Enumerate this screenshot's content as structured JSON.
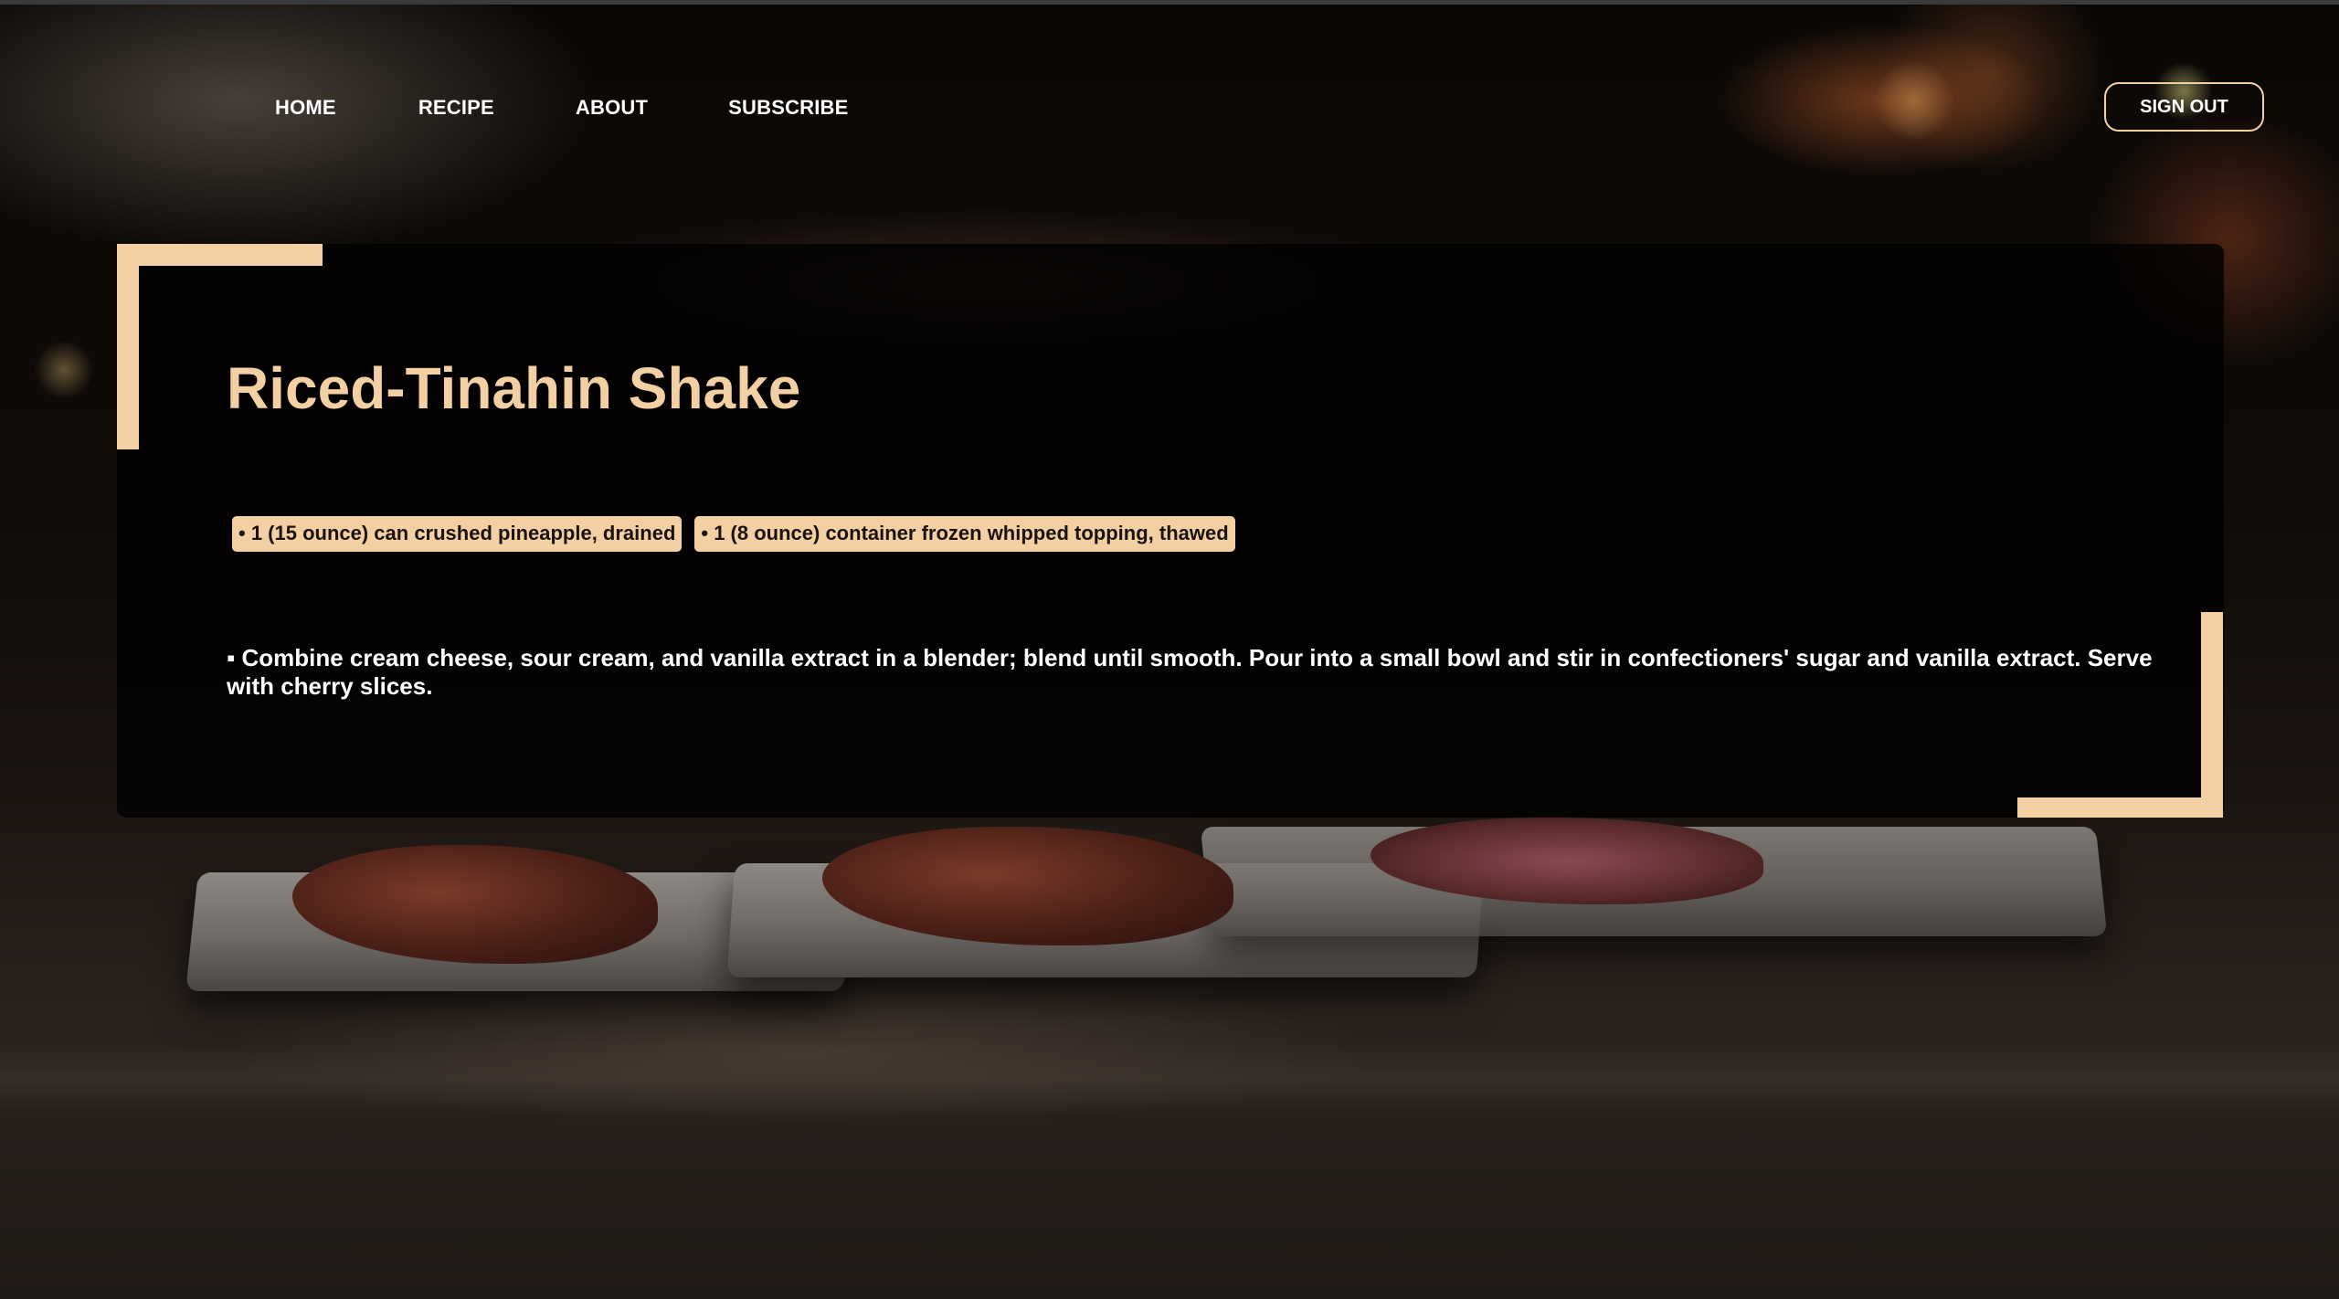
{
  "nav": {
    "items": [
      {
        "label": "HOME"
      },
      {
        "label": "RECIPE"
      },
      {
        "label": "ABOUT"
      },
      {
        "label": "SUBSCRIBE"
      }
    ],
    "signout_label": "SIGN OUT"
  },
  "recipe": {
    "title": "Riced-Tinahin Shake",
    "ingredients": [
      "• 1 (15 ounce) can crushed pineapple, drained",
      "• 1 (8 ounce) container frozen whipped topping, thawed"
    ],
    "instructions": "▪ Combine cream cheese, sour cream, and vanilla extract in a blender; blend until smooth. Pour into a small bowl and stir in confectioners' sugar and vanilla extract. Serve with cherry slices."
  },
  "colors": {
    "accent": "#f3d0a4",
    "card_background": "rgba(0,0,0,0.78)",
    "text": "#ffffff"
  }
}
